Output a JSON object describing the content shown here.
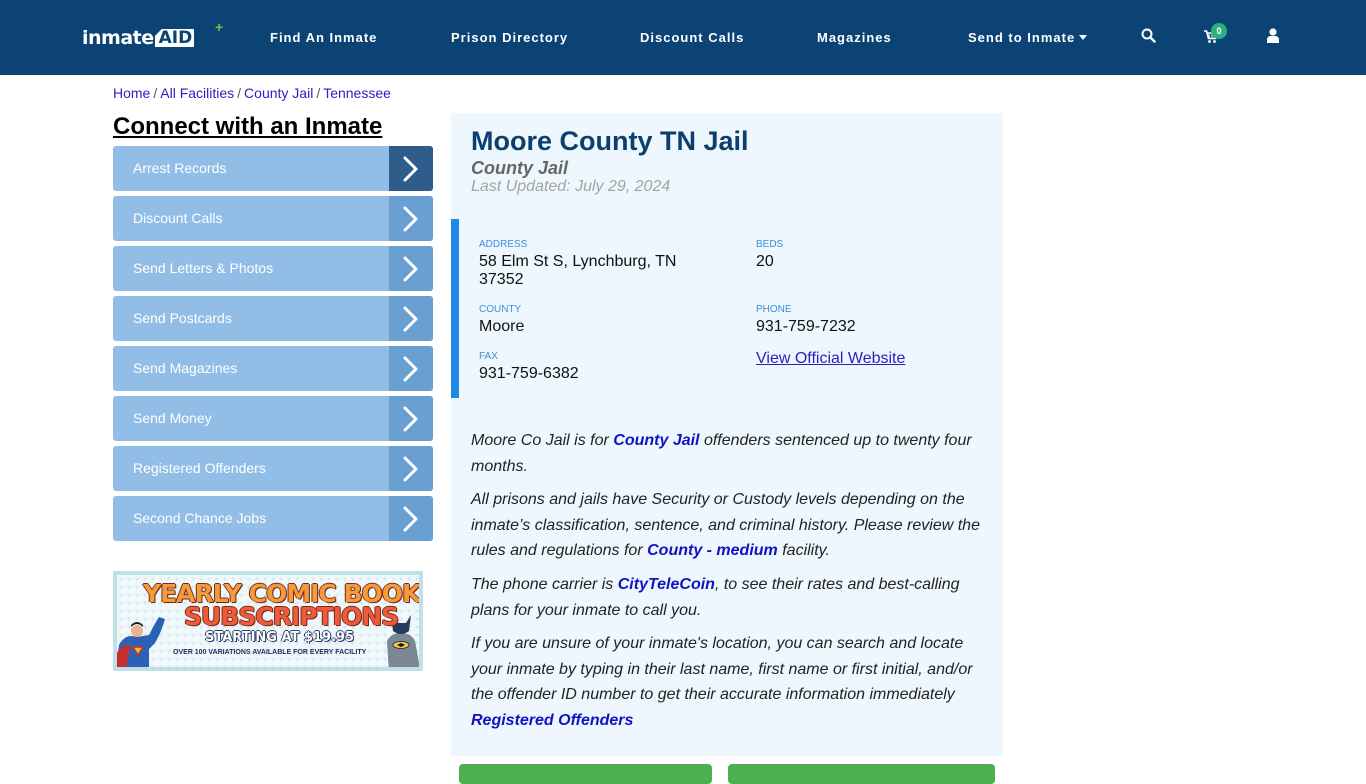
{
  "navbar": {
    "logo_text": "inmate",
    "logo_accent": "AID",
    "items": [
      {
        "label": "Find An Inmate"
      },
      {
        "label": "Prison Directory"
      },
      {
        "label": "Discount Calls"
      },
      {
        "label": "Magazines"
      },
      {
        "label": "Send to Inmate",
        "has_dropdown": true
      }
    ],
    "icons": [
      "search-icon",
      "cart-icon",
      "user-icon"
    ],
    "cart_count": "0"
  },
  "breadcrumb": [
    {
      "label": "Home"
    },
    {
      "label": "All Facilities"
    },
    {
      "label": "County Jail"
    },
    {
      "label": "Tennessee"
    }
  ],
  "breadcrumb_separator": "/",
  "sidebar": {
    "title": "Connect with an Inmate",
    "items": [
      {
        "label": "Arrest Records"
      },
      {
        "label": "Discount Calls"
      },
      {
        "label": "Send Letters & Photos"
      },
      {
        "label": "Send Postcards"
      },
      {
        "label": "Send Magazines"
      },
      {
        "label": "Send Money"
      },
      {
        "label": "Registered Offenders"
      },
      {
        "label": "Second Chance Jobs"
      }
    ],
    "ad": {
      "line1": "YEARLY COMIC BOOK",
      "line2": "SUBSCRIPTIONS",
      "line3": "STARTING AT $19.95",
      "line4": "OVER 100 VARIATIONS AVAILABLE FOR EVERY FACILITY"
    }
  },
  "facility": {
    "name": "Moore County TN Jail",
    "type": "County Jail",
    "last_updated": "Last Updated: July 29, 2024",
    "fields": {
      "address": {
        "label": "ADDRESS",
        "value_line1": "58 Elm St S, Lynchburg, TN",
        "value_line2": "37352"
      },
      "beds": {
        "label": "BEDS",
        "value": "20"
      },
      "county": {
        "label": "COUNTY",
        "value": "Moore"
      },
      "phone": {
        "label": "PHONE",
        "value": "931-759-7232"
      },
      "fax": {
        "label": "FAX",
        "value": "931-759-6382"
      }
    },
    "website_link": "View Official Website"
  },
  "description": {
    "p1": {
      "before": "Moore Co Jail is for ",
      "link": "County Jail",
      "after": " offenders sentenced up to twenty four months."
    },
    "p2": {
      "before": "All prisons and jails have Security or Custody levels depending on the inmate’s classification, sentence, and criminal history. Please review the rules and regulations for ",
      "link": "County - medium",
      "after": " facility."
    },
    "p3": {
      "before": "The phone carrier is ",
      "link": "CityTeleCoin",
      "after": ", to see their rates and best-calling plans for your inmate to call you."
    },
    "p4": {
      "before": "If you are unsure of your inmate's location, you can search and locate your inmate by typing in their last name, first name or first initial, and/or the offender ID number to get their accurate information immediately ",
      "link": "Registered Offenders",
      "after": ""
    }
  },
  "colors": {
    "navbar": "#0b4375",
    "side_item": "#92bde7",
    "side_arrow": "#6a9fd2",
    "card_bg": "#edf7fd",
    "accent_bar": "#1e88e5",
    "link": "#1112c4",
    "green_button": "#4caf50"
  }
}
